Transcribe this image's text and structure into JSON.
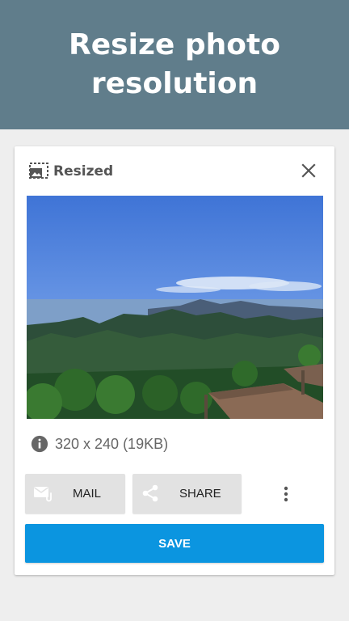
{
  "header": {
    "title": "Resize photo resolution"
  },
  "card": {
    "title": "Resized",
    "info": "320 x 240 (19KB)",
    "icons": {
      "title_icon": "resize-image-icon",
      "close": "close-icon",
      "info": "info-icon",
      "mail": "mail-attachment-icon",
      "share": "share-icon",
      "more": "more-vertical-icon"
    },
    "actions": {
      "mail_label": "MAIL",
      "share_label": "SHARE",
      "save_label": "SAVE"
    }
  },
  "colors": {
    "header_bg": "#607d8b",
    "page_bg": "#eeeeee",
    "save_button": "#0b95e0",
    "secondary_button": "#e2e2e2"
  }
}
